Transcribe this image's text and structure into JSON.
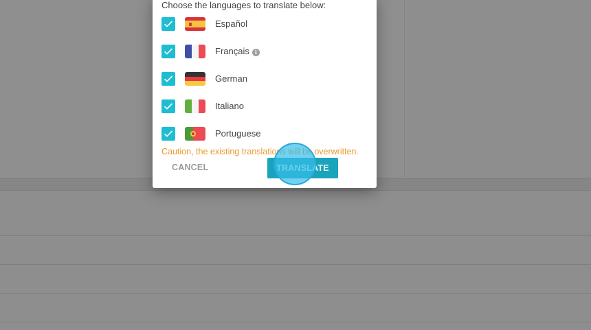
{
  "dialog": {
    "prompt": "Choose the languages to translate below:",
    "languages": [
      {
        "label": "Español",
        "checked": true,
        "flag": "spain-flag-icon"
      },
      {
        "label": "Français",
        "checked": true,
        "flag": "france-flag-icon",
        "info": true
      },
      {
        "label": "German",
        "checked": true,
        "flag": "germany-flag-icon"
      },
      {
        "label": "Italiano",
        "checked": true,
        "flag": "italy-flag-icon"
      },
      {
        "label": "Portuguese",
        "checked": true,
        "flag": "portugal-flag-icon"
      }
    ],
    "caution": "Caution, the existing translations will be overwritten.",
    "cancel_label": "CANCEL",
    "translate_label": "TRANSLATE",
    "info_glyph": "i"
  },
  "colors": {
    "checkbox": "#1fbdd1",
    "primary_button": "#1aa4bb",
    "caution_text": "#e89a2c",
    "overlay": "#8e8e8e"
  }
}
